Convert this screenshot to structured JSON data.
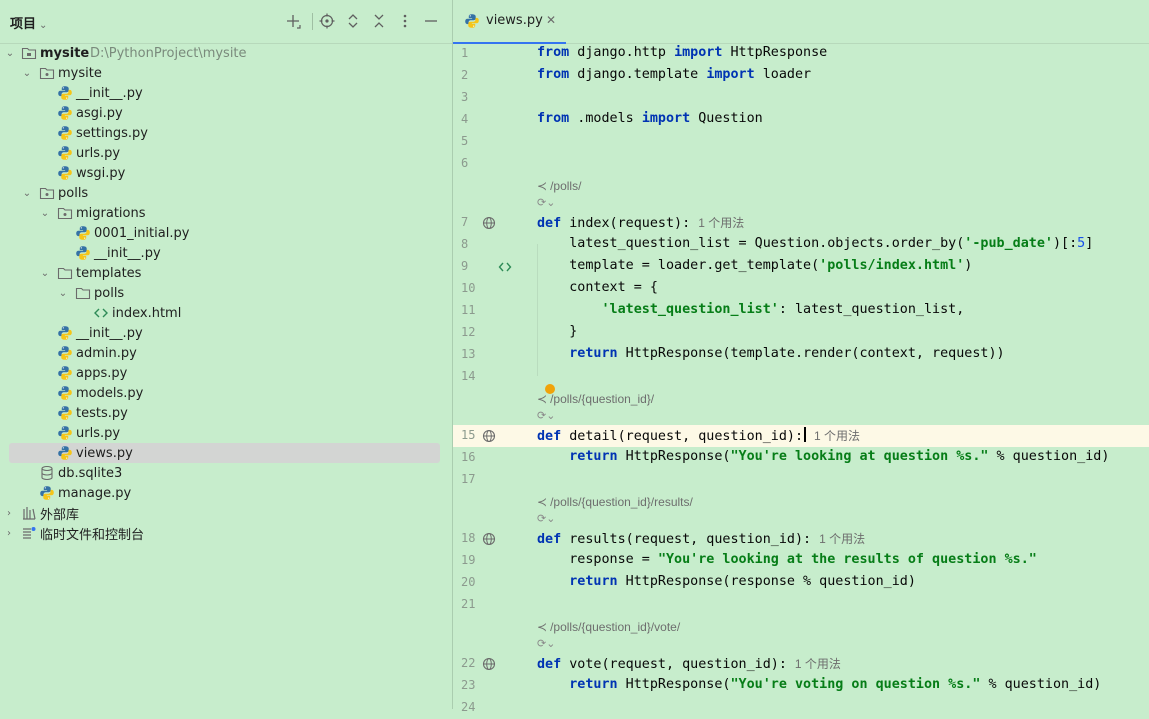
{
  "project_panel": {
    "title": "项目",
    "tree": [
      {
        "label": "mysite",
        "path": "D:\\PythonProject\\mysite",
        "icon": "folder-module-icon",
        "expanded": true
      },
      {
        "label": "mysite",
        "icon": "package-folder-icon",
        "expanded": true
      },
      {
        "label": "__init__.py",
        "icon": "python-file-icon"
      },
      {
        "label": "asgi.py",
        "icon": "python-file-icon"
      },
      {
        "label": "settings.py",
        "icon": "python-file-icon"
      },
      {
        "label": "urls.py",
        "icon": "python-file-icon"
      },
      {
        "label": "wsgi.py",
        "icon": "python-file-icon"
      },
      {
        "label": "polls",
        "icon": "package-folder-icon",
        "expanded": true
      },
      {
        "label": "migrations",
        "icon": "package-folder-icon",
        "expanded": true
      },
      {
        "label": "0001_initial.py",
        "icon": "python-file-icon"
      },
      {
        "label": "__init__.py",
        "icon": "python-file-icon"
      },
      {
        "label": "templates",
        "icon": "folder-icon",
        "expanded": true
      },
      {
        "label": "polls",
        "icon": "folder-icon",
        "expanded": true
      },
      {
        "label": "index.html",
        "icon": "html-file-icon"
      },
      {
        "label": "__init__.py",
        "icon": "python-file-icon"
      },
      {
        "label": "admin.py",
        "icon": "python-file-icon"
      },
      {
        "label": "apps.py",
        "icon": "python-file-icon"
      },
      {
        "label": "models.py",
        "icon": "python-file-icon"
      },
      {
        "label": "tests.py",
        "icon": "python-file-icon"
      },
      {
        "label": "urls.py",
        "icon": "python-file-icon"
      },
      {
        "label": "views.py",
        "icon": "python-file-icon",
        "selected": true
      },
      {
        "label": "db.sqlite3",
        "icon": "database-icon"
      },
      {
        "label": "manage.py",
        "icon": "python-file-icon"
      },
      {
        "label": "外部库",
        "icon": "library-icon",
        "expanded": false
      },
      {
        "label": "临时文件和控制台",
        "icon": "scratches-icon",
        "expanded": false
      }
    ]
  },
  "editor": {
    "tab_label": "views.py",
    "usage_hint": "1 个用法",
    "routes": [
      "/polls/",
      "/polls/{question_id}/",
      "/polls/{question_id}/results/",
      "/polls/{question_id}/vote/"
    ],
    "line_numbers": [
      "1",
      "2",
      "3",
      "4",
      "5",
      "6",
      "7",
      "8",
      "9",
      "10",
      "11",
      "12",
      "13",
      "14",
      "15",
      "16",
      "17",
      "18",
      "19",
      "20",
      "21",
      "22",
      "23",
      "24"
    ],
    "code": {
      "l1_from": "from",
      "l1_mod": " django.http ",
      "l1_import": "import",
      "l1_name": " HttpResponse",
      "l2_from": "from",
      "l2_mod": " django.template ",
      "l2_import": "import",
      "l2_name": " loader",
      "l4_from": "from",
      "l4_mod": " .models ",
      "l4_import": "import",
      "l4_name": " Question",
      "l7_def": "def",
      "l7_rest": " index(request):",
      "l8_a": "    latest_question_list = Question.objects.order_by(",
      "l8_str": "'-pub_date'",
      "l8_b": ")[:",
      "l8_num": "5",
      "l8_c": "]",
      "l9_a": "    template = loader.get_template(",
      "l9_str": "'polls/index.html'",
      "l9_b": ")",
      "l10": "    context = {",
      "l11_indent": "        ",
      "l11_str": "'latest_question_list'",
      "l11_b": ": latest_question_list,",
      "l12": "    }",
      "l13_indent": "    ",
      "l13_kw": "return",
      "l13_rest": " HttpResponse(template.render(context, request))",
      "l15_def": "def",
      "l15_rest": " detail(request, question_id):",
      "l16_indent": "    ",
      "l16_kw": "return",
      "l16_a": " HttpResponse(",
      "l16_str": "\"You're looking at question %s.\"",
      "l16_b": " % question_id)",
      "l18_def": "def",
      "l18_rest": " results(request, question_id):",
      "l19_a": "    response = ",
      "l19_str": "\"You're looking at the results of question %s.\"",
      "l20_indent": "    ",
      "l20_kw": "return",
      "l20_rest": " HttpResponse(response % question_id)",
      "l22_def": "def",
      "l22_rest": " vote(request, question_id):",
      "l23_indent": "    ",
      "l23_kw": "return",
      "l23_a": " HttpResponse(",
      "l23_str": "\"You're voting on question %s.\"",
      "l23_b": " % question_id)"
    }
  },
  "colors": {
    "background": "#c7edcc",
    "keyword": "#0033b3",
    "string": "#067d17",
    "number": "#1750eb",
    "current_line": "#fdf9e6",
    "selection": "#d3d5d3",
    "tab_underline": "#3574f0"
  }
}
